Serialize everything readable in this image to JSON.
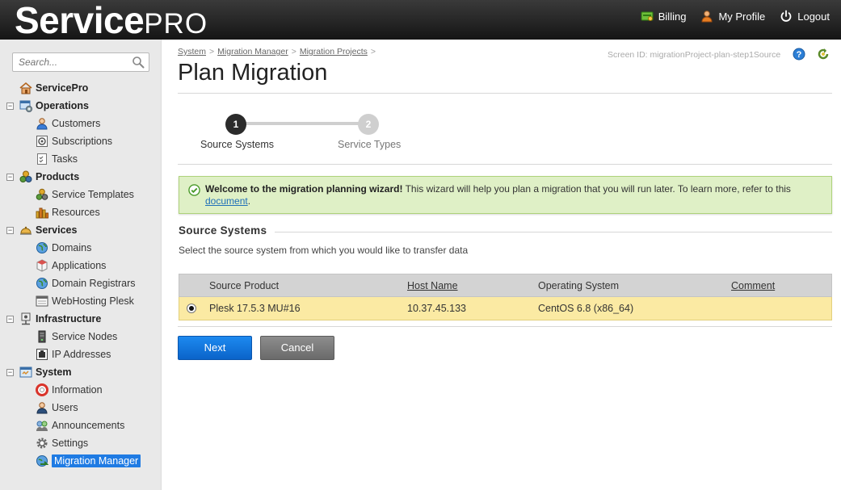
{
  "header": {
    "logo_service": "Service",
    "logo_pro": "PRO",
    "nav": [
      {
        "label": "Billing",
        "icon": "billing-icon"
      },
      {
        "label": "My Profile",
        "icon": "user-icon"
      },
      {
        "label": "Logout",
        "icon": "power-icon"
      }
    ]
  },
  "sidebar": {
    "search_placeholder": "Search...",
    "tree": [
      {
        "label": "ServicePro",
        "kind": "root",
        "icon": "home-icon"
      },
      {
        "label": "Operations",
        "kind": "category",
        "icon": "operations-icon"
      },
      {
        "label": "Customers",
        "kind": "item",
        "icon": "customer-icon"
      },
      {
        "label": "Subscriptions",
        "kind": "item",
        "icon": "subscription-icon"
      },
      {
        "label": "Tasks",
        "kind": "item",
        "icon": "tasks-icon"
      },
      {
        "label": "Products",
        "kind": "category",
        "icon": "products-icon"
      },
      {
        "label": "Service Templates",
        "kind": "item",
        "icon": "template-icon"
      },
      {
        "label": "Resources",
        "kind": "item",
        "icon": "resources-icon"
      },
      {
        "label": "Services",
        "kind": "category",
        "icon": "services-icon"
      },
      {
        "label": "Domains",
        "kind": "item",
        "icon": "globe-icon"
      },
      {
        "label": "Applications",
        "kind": "item",
        "icon": "cube-icon"
      },
      {
        "label": "Domain Registrars",
        "kind": "item",
        "icon": "globe-icon"
      },
      {
        "label": "WebHosting Plesk",
        "kind": "item",
        "icon": "window-icon"
      },
      {
        "label": "Infrastructure",
        "kind": "category",
        "icon": "infrastructure-icon"
      },
      {
        "label": "Service Nodes",
        "kind": "item",
        "icon": "server-icon"
      },
      {
        "label": "IP Addresses",
        "kind": "item",
        "icon": "ip-icon"
      },
      {
        "label": "System",
        "kind": "category",
        "icon": "system-icon"
      },
      {
        "label": "Information",
        "kind": "item",
        "icon": "lifebuoy-icon"
      },
      {
        "label": "Users",
        "kind": "item",
        "icon": "users-icon"
      },
      {
        "label": "Announcements",
        "kind": "item",
        "icon": "announcement-icon"
      },
      {
        "label": "Settings",
        "kind": "item",
        "icon": "gear-icon"
      },
      {
        "label": "Migration Manager",
        "kind": "item",
        "icon": "migration-icon",
        "active": true
      }
    ]
  },
  "main": {
    "breadcrumb": [
      "System",
      "Migration Manager",
      "Migration Projects"
    ],
    "screen_id": "Screen ID:  migrationProject-plan-step1Source",
    "title": "Plan Migration",
    "steps": [
      {
        "number": "1",
        "label": "Source Systems"
      },
      {
        "number": "2",
        "label": "Service Types"
      }
    ],
    "alert": {
      "bold": "Welcome to the migration planning wizard!",
      "text": " This wizard will help you plan a migration that you will run later. To learn more, refer to this ",
      "link": "document",
      "tail": "."
    },
    "section_title": "Source Systems",
    "section_desc": "Select the source system from which you would like to transfer data",
    "table": {
      "columns": [
        "Source Product",
        "Host Name",
        "Operating System",
        "Comment"
      ],
      "rows": [
        {
          "product": "Plesk 17.5.3 MU#16",
          "host": "10.37.45.133",
          "os": "CentOS 6.8 (x86_64)",
          "comment": ""
        }
      ]
    },
    "buttons": {
      "next": "Next",
      "cancel": "Cancel"
    }
  },
  "colors": {
    "primary_button": "#1d8af0",
    "active_nav": "#1f7be3",
    "alert_bg": "#dff0c6",
    "selected_row": "#fbeaa3"
  }
}
